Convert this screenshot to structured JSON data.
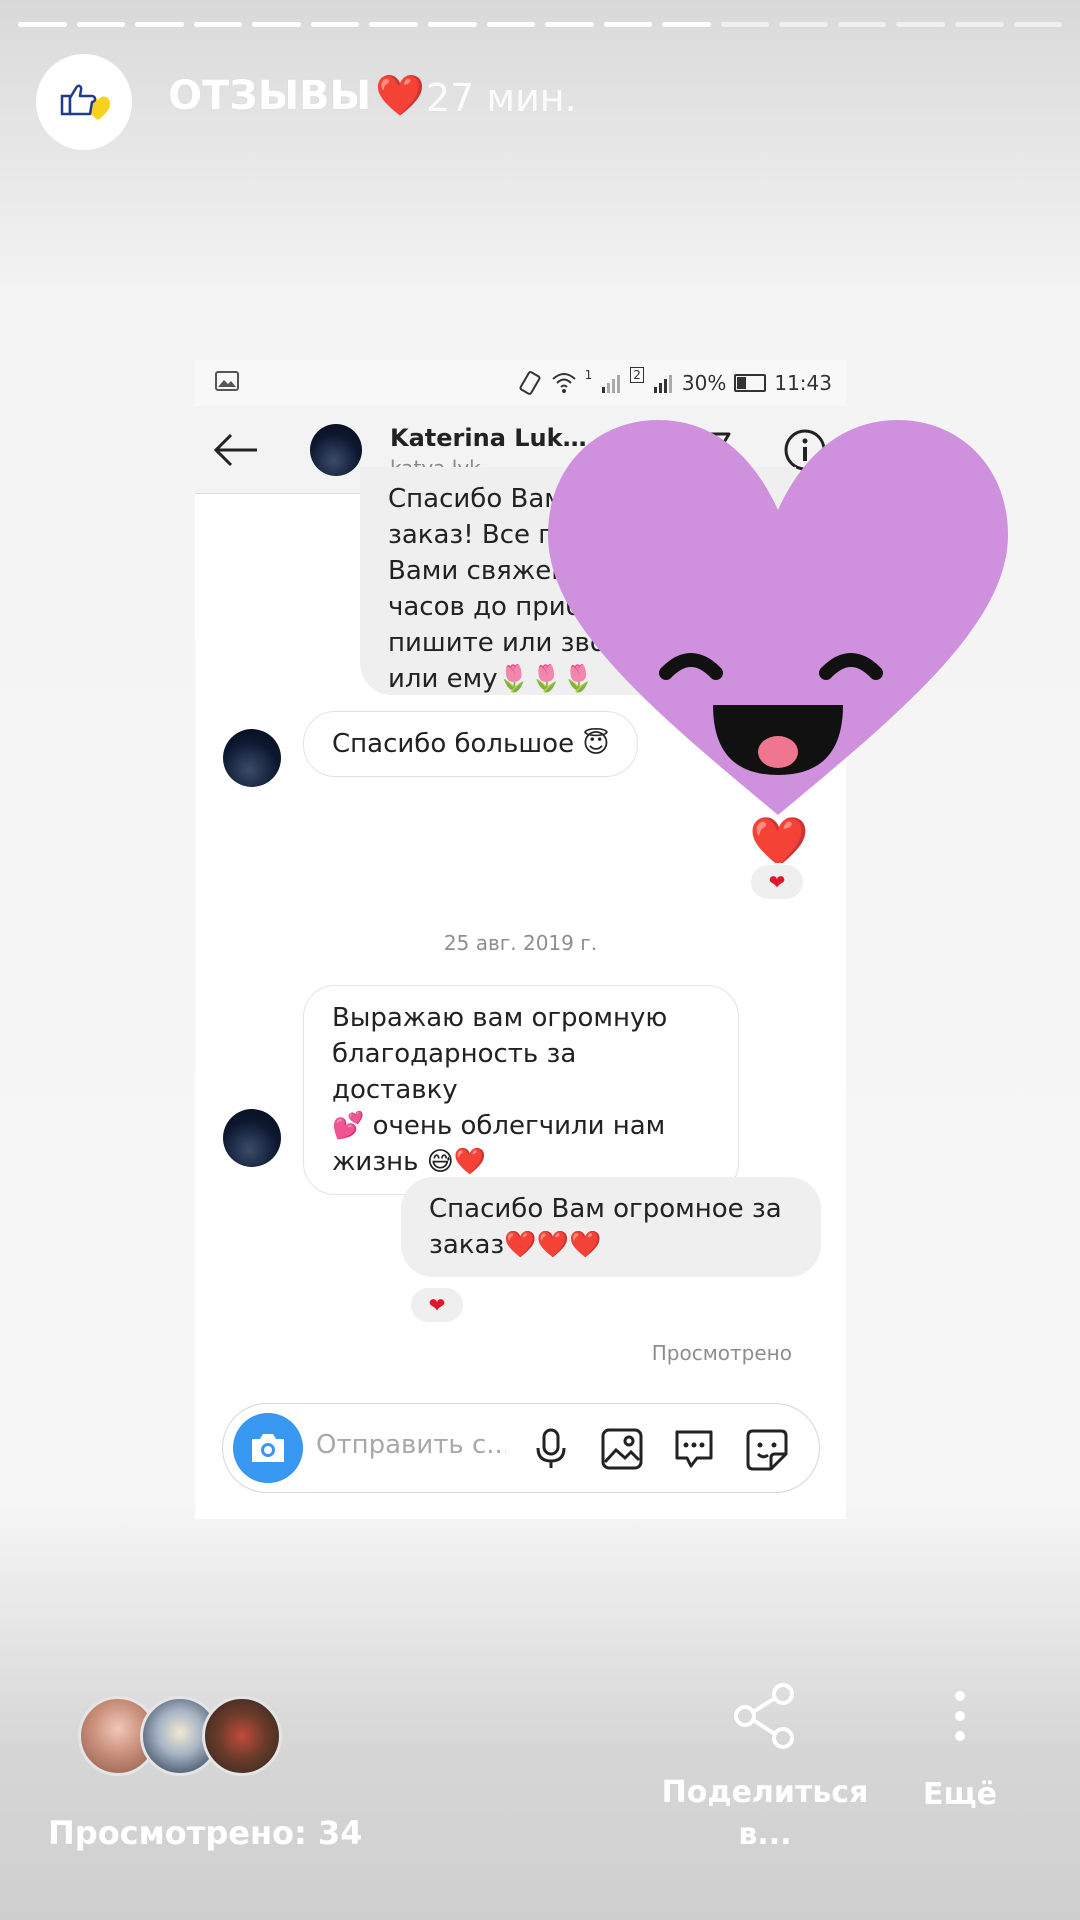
{
  "story": {
    "title": "ОТЗЫВЫ",
    "title_emoji": "❤️",
    "time": "27 мин.",
    "segments_total": 18,
    "segments_done": 12,
    "avatar_icon": "thumbs-up-heart-logo"
  },
  "screenshot": {
    "status_bar": {
      "image_icon": "gallery-icon",
      "sim1": "1",
      "sim2": "2",
      "battery": "30%",
      "time": "11:43"
    },
    "header": {
      "name": "Katerina Luk…",
      "username": "katya.lyk"
    },
    "messages": {
      "m1": "Спасибо Вам за\nзаказ! Все подробно с\nВами свяжемся за пару\nчасов до прибытия,\nпишите или звоните\nили ему🌷🌷🌷",
      "m2": "Спасибо большое 😇",
      "m2_reaction": "❤",
      "m3_heart": "❤️",
      "date": "25 авг. 2019 г.",
      "m4": "Выражаю вам огромную\nблагодарность за доставку\n💕 очень облегчили нам\nжизнь 😅❤️",
      "m5": "Спасибо Вам огромное за\nзаказ❤️❤️❤️",
      "m5_reaction": "❤",
      "seen": "Просмотрено"
    },
    "composer": {
      "placeholder": "Отправить с..."
    }
  },
  "footer": {
    "viewed": "Просмотрено: 34",
    "share_label": "Поделиться\nв...",
    "more_label": "Ещё"
  },
  "colors": {
    "accent_blue": "#3897f0",
    "heart_sticker": "#cf91de",
    "reaction_red": "#e0162b"
  }
}
